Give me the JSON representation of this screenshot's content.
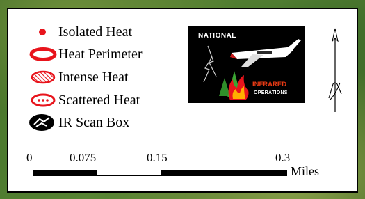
{
  "legend": {
    "items": [
      {
        "label": "Isolated Heat",
        "icon": "isolated-heat-dot-icon"
      },
      {
        "label": "Heat Perimeter",
        "icon": "heat-perimeter-ring-icon"
      },
      {
        "label": "Intense Heat",
        "icon": "intense-heat-hatched-icon"
      },
      {
        "label": "Scattered Heat",
        "icon": "scattered-heat-dotted-icon"
      },
      {
        "label": "IR Scan Box",
        "icon": "ir-scan-box-icon"
      }
    ],
    "colors": {
      "heat": "#e8141c",
      "scan_box": "#000000"
    }
  },
  "logo": {
    "title": "NATIONAL",
    "subtitle": "INFRARED",
    "tagline": "OPERATIONS",
    "icons": [
      "airplane-icon",
      "lightning-icon",
      "trees-icon",
      "fire-icon"
    ]
  },
  "north_arrow": {
    "icon": "north-arrow-icon"
  },
  "scale": {
    "ticks": [
      "0",
      "0.075",
      "0.15",
      "0.3"
    ],
    "units": "Miles",
    "segments": [
      {
        "from": 0,
        "to": 0.075,
        "color": "#000000"
      },
      {
        "from": 0.075,
        "to": 0.15,
        "color": "#ffffff"
      },
      {
        "from": 0.15,
        "to": 0.3,
        "color": "#000000"
      }
    ],
    "max": 0.3
  }
}
